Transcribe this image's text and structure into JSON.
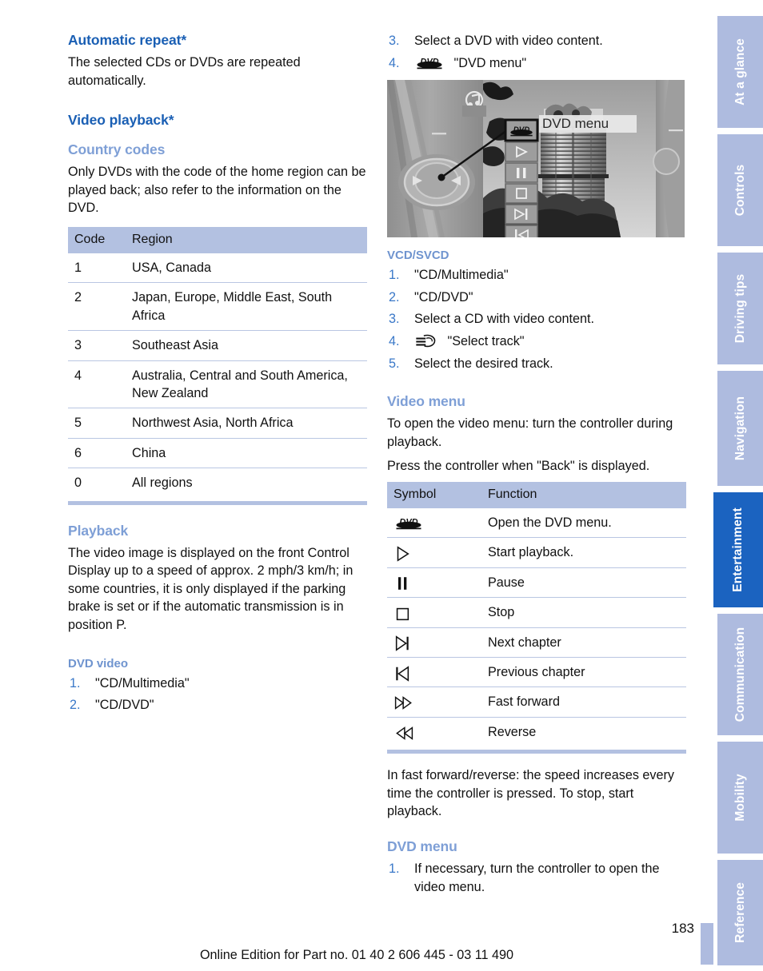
{
  "page": {
    "number": "183",
    "edition_note": "Online Edition for Part no. 01 40 2 606 445 - 03 11 490"
  },
  "sidebar": {
    "tabs": [
      {
        "label": "At a glance",
        "active": false
      },
      {
        "label": "Controls",
        "active": false
      },
      {
        "label": "Driving tips",
        "active": false
      },
      {
        "label": "Navigation",
        "active": false
      },
      {
        "label": "Entertainment",
        "active": true
      },
      {
        "label": "Communication",
        "active": false
      },
      {
        "label": "Mobility",
        "active": false
      },
      {
        "label": "Reference",
        "active": false
      }
    ],
    "active_color": "#1b63c0",
    "inactive_color": "#aebbdf"
  },
  "left_column": {
    "automatic_repeat": {
      "heading": "Automatic repeat*",
      "paragraph": "The selected CDs or DVDs are repeated automatically."
    },
    "video_playback": {
      "heading": "Video playback*"
    },
    "country_codes": {
      "heading": "Country codes",
      "paragraph": "Only DVDs with the code of the home region can be played back; also refer to the information on the DVD.",
      "table": {
        "columns": [
          "Code",
          "Region"
        ],
        "rows": [
          {
            "code": "1",
            "region": "USA, Canada"
          },
          {
            "code": "2",
            "region": "Japan, Europe, Middle East, South Africa"
          },
          {
            "code": "3",
            "region": "Southeast Asia"
          },
          {
            "code": "4",
            "region": "Australia, Central and South America, New Zealand"
          },
          {
            "code": "5",
            "region": "Northwest Asia, North Africa"
          },
          {
            "code": "6",
            "region": "China"
          },
          {
            "code": "0",
            "region": "All regions"
          }
        ]
      }
    },
    "playback": {
      "heading": "Playback",
      "paragraph": "The video image is displayed on the front Control Display up to a speed of approx. 2 mph/3 km/h; in some countries, it is only displayed if the parking brake is set or if the automatic transmission is in position P."
    },
    "dvd_video": {
      "heading": "DVD video",
      "steps": [
        {
          "num": "1.",
          "text": "\"CD/Multimedia\"",
          "icon": null
        },
        {
          "num": "2.",
          "text": "\"CD/DVD\"",
          "icon": null
        }
      ]
    }
  },
  "right_column": {
    "dvd_video_continued": {
      "steps": [
        {
          "num": "3.",
          "text": "Select a DVD with video content.",
          "icon": null
        },
        {
          "num": "4.",
          "text": "\"DVD menu\"",
          "icon": "dvd-logo-icon"
        }
      ]
    },
    "figure": {
      "caption_label": "DVD menu",
      "alt": "Control Display showing video playback with DVD menu strip and BMW Four-Cylinder building",
      "menu_icons": [
        "dvd-logo-icon",
        "play-icon",
        "pause-icon",
        "stop-icon",
        "next-chapter-icon",
        "previous-chapter-icon",
        "fast-forward-icon",
        "reverse-icon"
      ]
    },
    "vcd_svcd": {
      "heading": "VCD/SVCD",
      "steps": [
        {
          "num": "1.",
          "text": "\"CD/Multimedia\"",
          "icon": null
        },
        {
          "num": "2.",
          "text": "\"CD/DVD\"",
          "icon": null
        },
        {
          "num": "3.",
          "text": "Select a CD with video content.",
          "icon": null
        },
        {
          "num": "4.",
          "text": "\"Select track\"",
          "icon": "select-track-icon"
        },
        {
          "num": "5.",
          "text": "Select the desired track.",
          "icon": null
        }
      ]
    },
    "video_menu": {
      "heading": "Video menu",
      "paragraph_1": "To open the video menu: turn the controller during playback.",
      "paragraph_2": "Press the controller when \"Back\" is displayed.",
      "table": {
        "columns": [
          "Symbol",
          "Function"
        ],
        "rows": [
          {
            "icon": "dvd-logo-icon",
            "function": "Open the DVD menu."
          },
          {
            "icon": "play-icon",
            "function": "Start playback."
          },
          {
            "icon": "pause-icon",
            "function": "Pause"
          },
          {
            "icon": "stop-icon",
            "function": "Stop"
          },
          {
            "icon": "next-chapter-icon",
            "function": "Next chapter"
          },
          {
            "icon": "previous-chapter-icon",
            "function": "Previous chapter"
          },
          {
            "icon": "fast-forward-icon",
            "function": "Fast forward"
          },
          {
            "icon": "reverse-icon",
            "function": "Reverse"
          }
        ]
      },
      "note": "In fast forward/reverse: the speed increases every time the controller is pressed. To stop, start playback."
    },
    "dvd_menu": {
      "heading": "DVD menu",
      "steps": [
        {
          "num": "1.",
          "text": "If necessary, turn the controller to open the video menu.",
          "icon": null
        }
      ]
    }
  },
  "colors": {
    "heading_major": "#1a5fb4",
    "heading_minor": "#7e9fd6",
    "table_header_bg": "#b3c1e1",
    "step_number": "#3a78c8"
  }
}
